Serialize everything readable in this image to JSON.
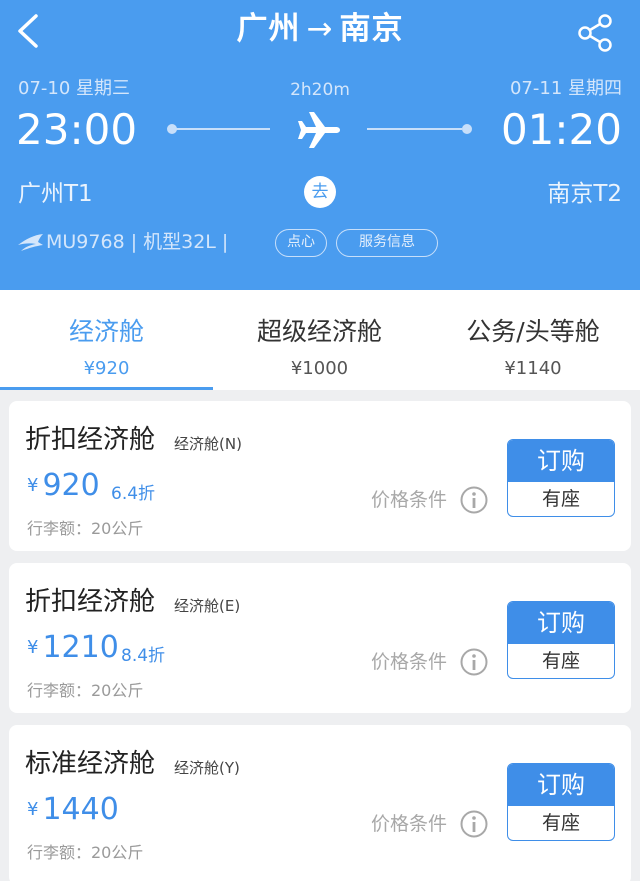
{
  "header": {
    "route_from": "广州",
    "route_arrow": "→",
    "route_to": "南京",
    "dep_date": "07-10 星期三",
    "arr_date": "07-11 星期四",
    "duration": "2h20m",
    "dep_time": "23:00",
    "arr_time": "01:20",
    "dep_airport": "广州T1",
    "arr_airport": "南京T2",
    "trip_badge": "去",
    "flight_info": "MU9768 | 机型32L |",
    "meal_pill": "点心",
    "service_pill": "服务信息",
    "colors": {
      "background": "#4a9cef",
      "accent": "#3f8ee8"
    }
  },
  "tabs": [
    {
      "name": "经济舱",
      "price": "¥920",
      "active": true
    },
    {
      "name": "超级经济舱",
      "price": "¥1000",
      "active": false
    },
    {
      "name": "公务/头等舱",
      "price": "¥1140",
      "active": false
    }
  ],
  "fares": [
    {
      "name": "折扣经济舱",
      "code": "经济舱(N)",
      "currency": "¥",
      "price": "920",
      "discount": "6.4折",
      "baggage": "行李额：20公斤",
      "conditions": "价格条件",
      "book": "订购",
      "seat": "有座"
    },
    {
      "name": "折扣经济舱",
      "code": "经济舱(E)",
      "currency": "¥",
      "price": "1210",
      "discount": "8.4折",
      "baggage": "行李额：20公斤",
      "conditions": "价格条件",
      "book": "订购",
      "seat": "有座"
    },
    {
      "name": "标准经济舱",
      "code": "经济舱(Y)",
      "currency": "¥",
      "price": "1440",
      "discount": "",
      "baggage": "行李额：20公斤",
      "conditions": "价格条件",
      "book": "订购",
      "seat": "有座"
    }
  ],
  "icons": {
    "back": "back-chevron-icon",
    "share": "share-icon",
    "plane": "airplane-icon",
    "airline": "airline-logo-icon",
    "info": "info-icon"
  }
}
